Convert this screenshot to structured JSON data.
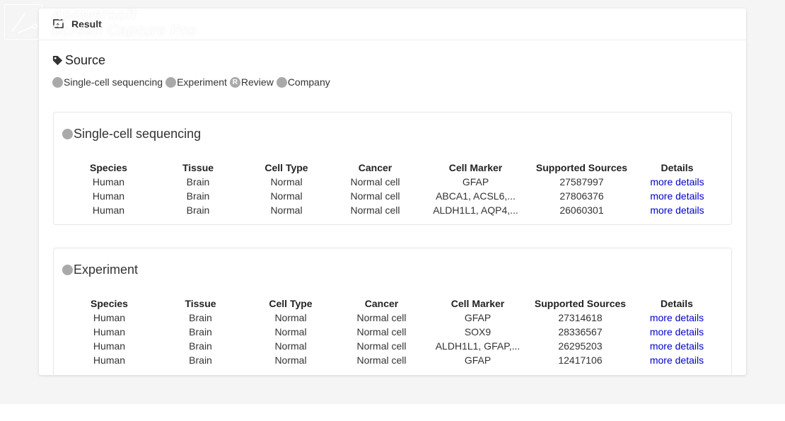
{
  "header": {
    "title": "Result"
  },
  "source": {
    "title": "Source",
    "legend": [
      {
        "label": "Single-cell sequencing",
        "icon": "single-cell-icon"
      },
      {
        "label": "Experiment",
        "icon": "experiment-icon"
      },
      {
        "label": "Review",
        "icon": "review-icon",
        "glyph": "R"
      },
      {
        "label": "Company",
        "icon": "company-icon"
      }
    ]
  },
  "columns": [
    "Species",
    "Tissue",
    "Cell Type",
    "Cancer",
    "Cell Marker",
    "Supported Sources",
    "Details"
  ],
  "panels": [
    {
      "title": "Single-cell sequencing",
      "rows": [
        [
          "Human",
          "Brain",
          "Normal",
          "Normal cell",
          "GFAP",
          "27587997",
          "more details"
        ],
        [
          "Human",
          "Brain",
          "Normal",
          "Normal cell",
          "ABCA1, ACSL6,...",
          "27806376",
          "more details"
        ],
        [
          "Human",
          "Brain",
          "Normal",
          "Normal cell",
          "ALDH1L1, AQP4,...",
          "26060301",
          "more details"
        ]
      ]
    },
    {
      "title": "Experiment",
      "rows": [
        [
          "Human",
          "Brain",
          "Normal",
          "Normal cell",
          "GFAP",
          "27314618",
          "more details"
        ],
        [
          "Human",
          "Brain",
          "Normal",
          "Normal cell",
          "SOX9",
          "28336567",
          "more details"
        ],
        [
          "Human",
          "Brain",
          "Normal",
          "Normal cell",
          "ALDH1L1, GFAP,...",
          "26295203",
          "more details"
        ],
        [
          "Human",
          "Brain",
          "Normal",
          "Normal cell",
          "GFAP",
          "12417106",
          "more details"
        ]
      ]
    }
  ],
  "watermark": {
    "line1": "Apowersoft",
    "line2": "Screen Capture Pro"
  }
}
